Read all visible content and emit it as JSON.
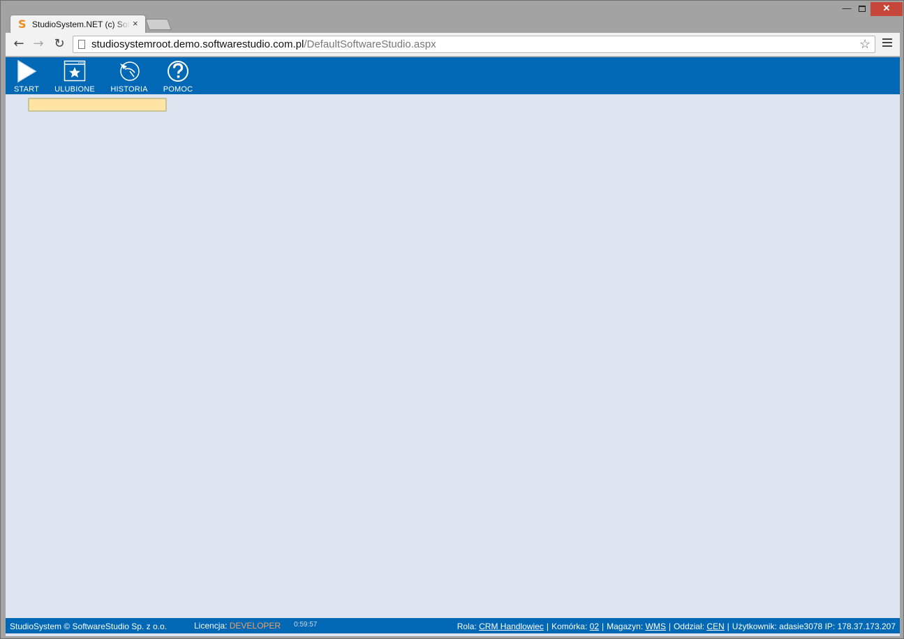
{
  "browser": {
    "tab_title": "StudioSystem.NET (c) Software",
    "tab_close": "×",
    "url_host": "studiosystemroot.demo.softwarestudio.com.pl",
    "url_path": "/DefaultSoftwareStudio.aspx",
    "window_controls": {
      "minimize": "—",
      "close": "✕"
    }
  },
  "appbar": {
    "items": [
      {
        "label": "START",
        "icon": "play-icon"
      },
      {
        "label": "ULUBIONE",
        "icon": "star-window-icon"
      },
      {
        "label": "HISTORIA",
        "icon": "history-icon"
      },
      {
        "label": "POMOC",
        "icon": "help-icon"
      }
    ]
  },
  "search": {
    "value": "",
    "placeholder": ""
  },
  "statusbar": {
    "copyright": "StudioSystem © SoftwareStudio Sp. z o.o.",
    "license_label": "Licencja:",
    "license_value": "DEVELOPER",
    "session_time": "0:59:57",
    "role_label": "Rola:",
    "role_value": "CRM Handlowiec",
    "cell_label": "Komórka:",
    "cell_value": "02",
    "warehouse_label": "Magazyn:",
    "warehouse_value": "WMS",
    "branch_label": "Oddział:",
    "branch_value": "CEN",
    "user_label": "Użytkownik:",
    "user_value": "adasie3078",
    "ip_label": "IP:",
    "ip_value": "178.37.173.207"
  },
  "colors": {
    "brand_blue": "#0068b5",
    "page_bg": "#dfe4f1",
    "input_highlight": "#ffe4a3",
    "license_accent": "#f0a36a"
  }
}
